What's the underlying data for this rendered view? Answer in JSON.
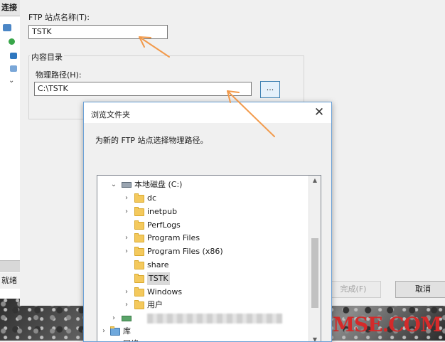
{
  "left_panel": {
    "connections_label": "连接",
    "status_text": "就绪"
  },
  "wizard": {
    "site_name_label": "FTP 站点名称(T):",
    "site_name_value": "TSTK",
    "content_dir_label": "内容目录",
    "physical_path_label": "物理路径(H):",
    "physical_path_value": "C:\\TSTK",
    "browse_label": "...",
    "finish_label": "完成(F)",
    "cancel_label": "取消"
  },
  "browse_dialog": {
    "title": "浏览文件夹",
    "close_glyph": "✕",
    "description": "为新的 FTP 站点选择物理路径。",
    "drive": "本地磁盘 (C:)",
    "folders": [
      {
        "name": "dc",
        "expandable": true
      },
      {
        "name": "inetpub",
        "expandable": true
      },
      {
        "name": "PerfLogs",
        "expandable": false
      },
      {
        "name": "Program Files",
        "expandable": true
      },
      {
        "name": "Program Files (x86)",
        "expandable": true
      },
      {
        "name": "share",
        "expandable": false
      },
      {
        "name": "TSTK",
        "expandable": false,
        "selected": true
      },
      {
        "name": "Windows",
        "expandable": true
      },
      {
        "name": "用户",
        "expandable": true
      }
    ],
    "library_label": "库",
    "network_label": "网络"
  },
  "watermark": "MSE.COM",
  "colors": {
    "arrow": "#f29a4b",
    "dialog_border": "#6aa0d6",
    "folder": "#f4c95d",
    "watermark": "#d42a2a"
  }
}
